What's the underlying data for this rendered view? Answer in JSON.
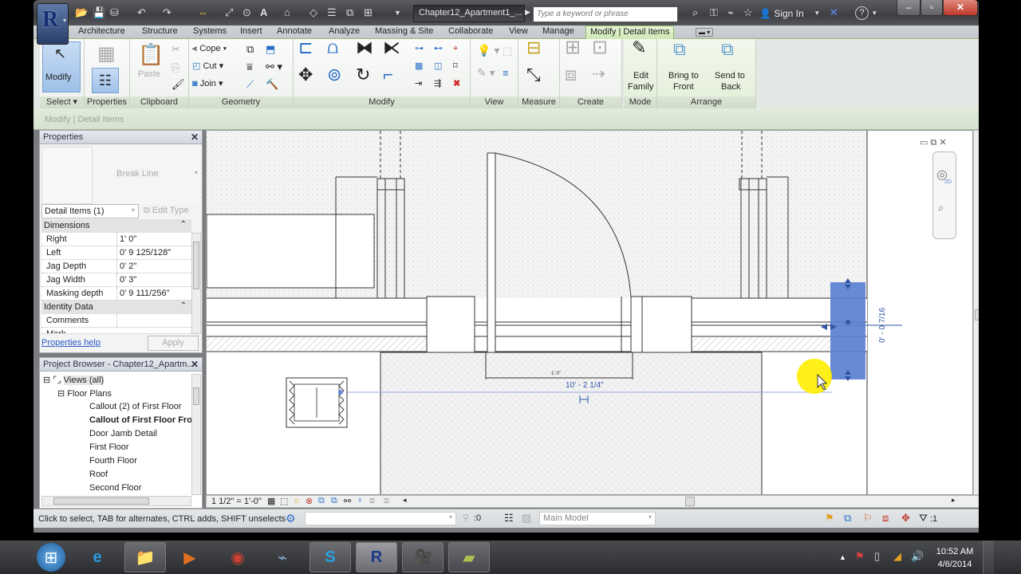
{
  "titlebar": {
    "document_title": "Chapter12_Apartment1_...",
    "search_placeholder": "Type a keyword or phrase",
    "sign_in": "Sign In"
  },
  "ribbon_tabs": [
    {
      "label": "Architecture"
    },
    {
      "label": "Structure"
    },
    {
      "label": "Systems"
    },
    {
      "label": "Insert"
    },
    {
      "label": "Annotate"
    },
    {
      "label": "Analyze"
    },
    {
      "label": "Massing & Site"
    },
    {
      "label": "Collaborate"
    },
    {
      "label": "View"
    },
    {
      "label": "Manage"
    },
    {
      "label": "Modify | Detail Items",
      "active": true
    }
  ],
  "ribbon": {
    "select": {
      "button": "Modify",
      "label": "Select"
    },
    "properties": {
      "label": "Properties"
    },
    "clipboard": {
      "paste": "Paste",
      "label": "Clipboard"
    },
    "geometry": {
      "cope": "Cope",
      "cut": "Cut",
      "join": "Join",
      "label": "Geometry"
    },
    "modify": {
      "label": "Modify"
    },
    "view": {
      "label": "View"
    },
    "measure": {
      "label": "Measure"
    },
    "create": {
      "label": "Create"
    },
    "mode": {
      "edit_family_1": "Edit",
      "edit_family_2": "Family",
      "label": "Mode"
    },
    "arrange": {
      "bring_1": "Bring to",
      "bring_2": "Front",
      "send_1": "Send to",
      "send_2": "Back",
      "label": "Arrange"
    }
  },
  "context_bar": "Modify | Detail Items",
  "properties": {
    "title": "Properties",
    "type_name": "Break Line",
    "filter": "Detail Items (1)",
    "edit_type": "Edit Type",
    "groups": [
      {
        "name": "Dimensions",
        "rows": [
          {
            "key": "Right",
            "value": "1'  0\""
          },
          {
            "key": "Left",
            "value": "0'  9 125/128\""
          },
          {
            "key": "Jag Depth",
            "value": "0'  2\""
          },
          {
            "key": "Jag Width",
            "value": "0'  3\""
          },
          {
            "key": "Masking depth",
            "value": "0'  9 111/256\""
          }
        ]
      },
      {
        "name": "Identity Data",
        "rows": [
          {
            "key": "Comments",
            "value": ""
          },
          {
            "key": "Mark",
            "value": ""
          }
        ]
      }
    ],
    "help_link": "Properties help",
    "apply": "Apply"
  },
  "project_browser": {
    "title": "Project Browser - Chapter12_Apartm...",
    "root": "Views (all)",
    "group": "Floor Plans",
    "items": [
      {
        "label": "Callout (2) of First Floor",
        "bold": false
      },
      {
        "label": "Callout of First Floor Fro",
        "bold": true
      },
      {
        "label": "Door Jamb Detail",
        "bold": false
      },
      {
        "label": "First Floor",
        "bold": false
      },
      {
        "label": "Fourth Floor",
        "bold": false
      },
      {
        "label": "Roof",
        "bold": false
      },
      {
        "label": "Second Floor",
        "bold": false
      }
    ]
  },
  "canvas": {
    "temp_dimension": "10' - 2 1/4\"",
    "vertical_dimension": "0' - 0 7/16",
    "small_dim_label": "1'-0\"",
    "nav_2d": "2D"
  },
  "view_control": {
    "scale": "1 1/2\" = 1'-0\""
  },
  "statusbar": {
    "hint": "Click to select, TAB for alternates, CTRL adds, SHIFT unselects",
    "worksets_count": ":0",
    "model": "Main Model",
    "filter_count": ":1"
  },
  "taskbar": {
    "time": "10:52 AM",
    "date": "4/6/2014",
    "apps": [
      "start",
      "internet-explorer",
      "file-explorer",
      "media-player",
      "chrome",
      "scanner",
      "skype",
      "revit",
      "camera",
      "notes"
    ]
  },
  "colors": {
    "accent_green": "#cfe8b4",
    "selection_blue": "#5b7fd0",
    "dimension_blue": "#2f56a6"
  }
}
